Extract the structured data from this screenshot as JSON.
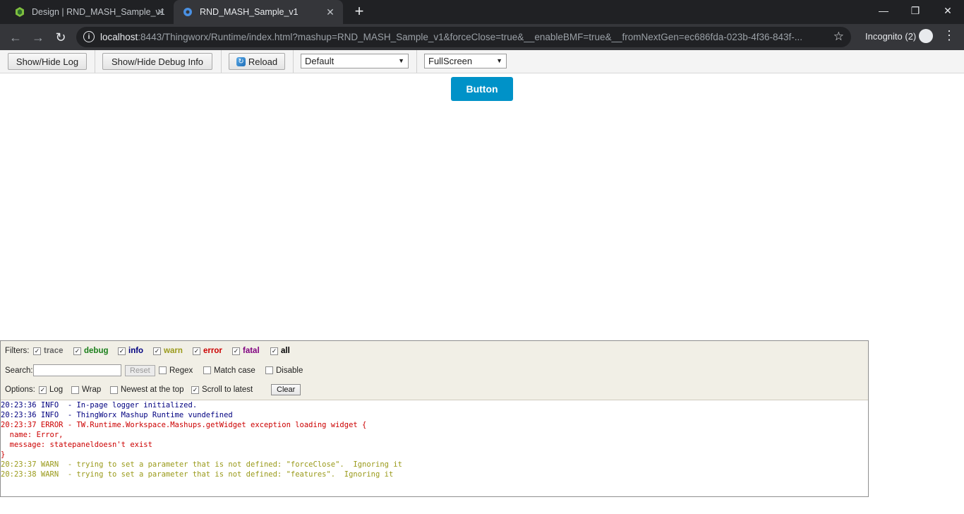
{
  "browser": {
    "tabs": [
      {
        "title": "Design | RND_MASH_Sample_v1",
        "active": false
      },
      {
        "title": "RND_MASH_Sample_v1",
        "active": true
      }
    ],
    "url_host": "localhost",
    "url_rest": ":8443/Thingworx/Runtime/index.html?mashup=RND_MASH_Sample_v1&forceClose=true&__enableBMF=true&__fromNextGen=ec686fda-023b-4f36-843f-...",
    "incognito_label": "Incognito (2)"
  },
  "debug_toolbar": {
    "show_hide_log": "Show/Hide Log",
    "show_hide_debug": "Show/Hide Debug Info",
    "reload": "Reload",
    "theme_select": "Default",
    "view_select": "FullScreen"
  },
  "mashup": {
    "button_label": "Button",
    "button_color": "#0092c8"
  },
  "log": {
    "filters_label": "Filters:",
    "filters": [
      {
        "label": "trace",
        "checked": true,
        "color": "#666666"
      },
      {
        "label": "debug",
        "checked": true,
        "color": "#1a7f1a"
      },
      {
        "label": "info",
        "checked": true,
        "color": "#000080"
      },
      {
        "label": "warn",
        "checked": true,
        "color": "#9a9a1a"
      },
      {
        "label": "error",
        "checked": true,
        "color": "#cc0000"
      },
      {
        "label": "fatal",
        "checked": true,
        "color": "#800080"
      },
      {
        "label": "all",
        "checked": true,
        "color": "#000000"
      }
    ],
    "search_label": "Search:",
    "reset_label": "Reset",
    "regex_label": "Regex",
    "match_case_label": "Match case",
    "disable_label": "Disable",
    "options_label": "Options:",
    "options": [
      {
        "label": "Log",
        "checked": true
      },
      {
        "label": "Wrap",
        "checked": false
      },
      {
        "label": "Newest at the top",
        "checked": false
      },
      {
        "label": "Scroll to latest",
        "checked": true
      }
    ],
    "clear_label": "Clear",
    "lines": [
      {
        "text": "20:23:36 INFO  - In-page logger initialized.",
        "color": "#000080"
      },
      {
        "text": "20:23:36 INFO  - ThingWorx Mashup Runtime vundefined",
        "color": "#000080"
      },
      {
        "text": "20:23:37 ERROR - TW.Runtime.Workspace.Mashups.getWidget exception loading widget {",
        "color": "#cc0000"
      },
      {
        "text": "  name: Error,",
        "color": "#cc0000"
      },
      {
        "text": "  message: statepaneldoesn't exist",
        "color": "#cc0000"
      },
      {
        "text": "}",
        "color": "#cc0000"
      },
      {
        "text": "20:23:37 WARN  - trying to set a parameter that is not defined: \"forceClose\".  Ignoring it",
        "color": "#9a9a1a"
      },
      {
        "text": "20:23:38 WARN  - trying to set a parameter that is not defined: \"features\".  Ignoring it",
        "color": "#9a9a1a"
      }
    ]
  }
}
